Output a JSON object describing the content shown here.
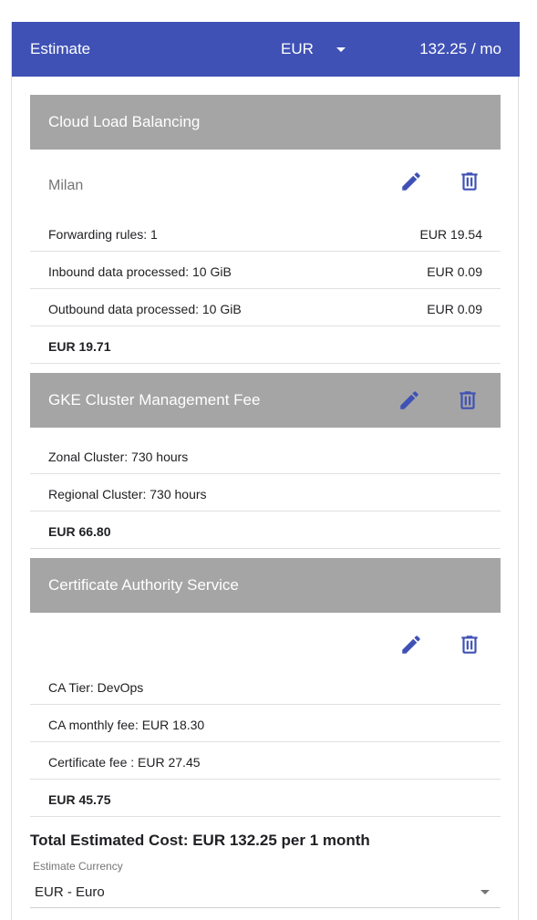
{
  "header": {
    "title": "Estimate",
    "currency": "EUR",
    "total": "132.25 / mo"
  },
  "colors": {
    "primary": "#3f51b5",
    "section_header": "#a5a5a5"
  },
  "icons": {
    "edit": "pencil-icon",
    "delete": "trash-icon"
  },
  "sections": [
    {
      "title": "Cloud Load Balancing",
      "region": "Milan",
      "items": [
        {
          "label": "Forwarding rules: 1",
          "price": "EUR 19.54"
        },
        {
          "label": "Inbound data processed: 10 GiB",
          "price": "EUR 0.09"
        },
        {
          "label": "Outbound data processed: 10 GiB",
          "price": "EUR 0.09"
        }
      ],
      "subtotal": "EUR 19.71"
    },
    {
      "title": "GKE Cluster Management Fee",
      "items": [
        {
          "label": "Zonal Cluster: 730 hours"
        },
        {
          "label": "Regional Cluster: 730 hours"
        }
      ],
      "subtotal": "EUR 66.80"
    },
    {
      "title": "Certificate Authority Service",
      "items": [
        {
          "label": "CA Tier: DevOps"
        },
        {
          "label": "CA monthly fee: EUR 18.30"
        },
        {
          "label": "Certificate fee : EUR 27.45"
        }
      ],
      "subtotal": "EUR 45.75"
    }
  ],
  "footer": {
    "total_text": "Total Estimated Cost: EUR 132.25 per 1 month",
    "currency_label": "Estimate Currency",
    "currency_value": "EUR - Euro"
  }
}
